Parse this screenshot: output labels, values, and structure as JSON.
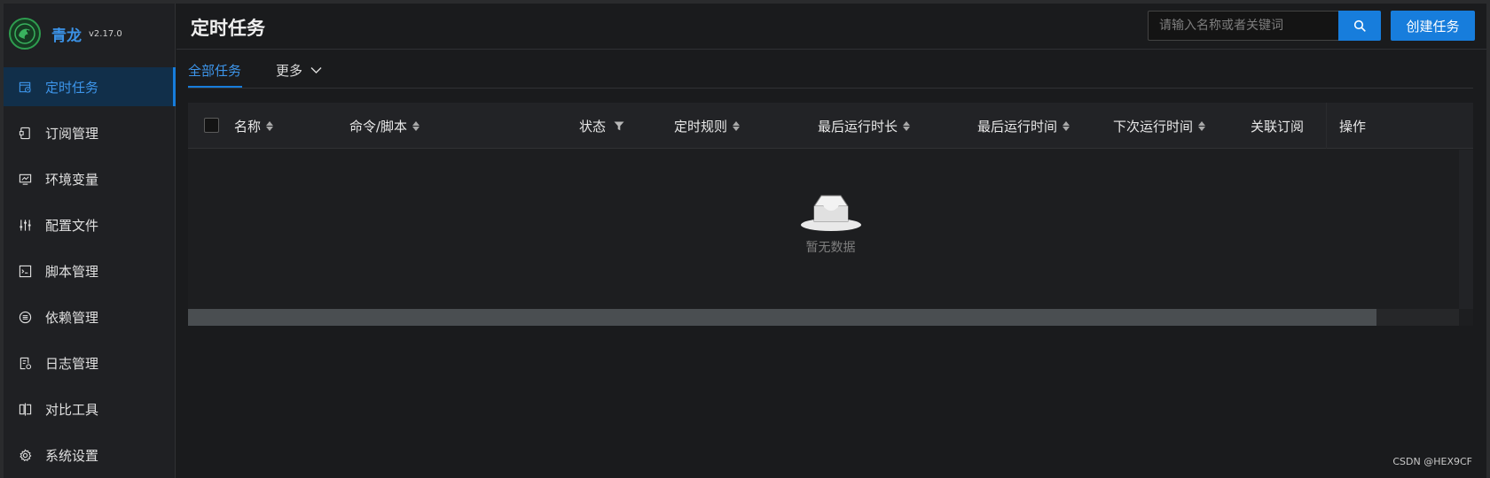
{
  "brand": {
    "name": "青龙",
    "version": "v2.17.0"
  },
  "sidebar": {
    "items": [
      {
        "label": "定时任务",
        "icon": "calendar-clock-icon",
        "active": true
      },
      {
        "label": "订阅管理",
        "icon": "subscription-icon",
        "active": false
      },
      {
        "label": "环境变量",
        "icon": "monitor-icon",
        "active": false
      },
      {
        "label": "配置文件",
        "icon": "sliders-icon",
        "active": false
      },
      {
        "label": "脚本管理",
        "icon": "code-file-icon",
        "active": false
      },
      {
        "label": "依赖管理",
        "icon": "list-circle-icon",
        "active": false
      },
      {
        "label": "日志管理",
        "icon": "log-file-icon",
        "active": false
      },
      {
        "label": "对比工具",
        "icon": "diff-icon",
        "active": false
      },
      {
        "label": "系统设置",
        "icon": "gear-icon",
        "active": false
      }
    ]
  },
  "header": {
    "title": "定时任务",
    "search_placeholder": "请输入名称或者关键词",
    "create_label": "创建任务"
  },
  "tabs": {
    "all_label": "全部任务",
    "more_label": "更多"
  },
  "table": {
    "columns": [
      {
        "label": "名称",
        "control": "sort"
      },
      {
        "label": "命令/脚本",
        "control": "sort"
      },
      {
        "label": "状态",
        "control": "filter"
      },
      {
        "label": "定时规则",
        "control": "sort"
      },
      {
        "label": "最后运行时长",
        "control": "sort"
      },
      {
        "label": "最后运行时间",
        "control": "sort"
      },
      {
        "label": "下次运行时间",
        "control": "sort"
      },
      {
        "label": "关联订阅",
        "control": "none"
      },
      {
        "label": "操作",
        "control": "none"
      }
    ],
    "empty_text": "暂无数据"
  },
  "watermark": "CSDN @HEX9CF",
  "colors": {
    "accent": "#177ddc",
    "background": "#1a1b1d",
    "sidebar_active_bg": "#112f4a",
    "brand_green": "#2e9d4f"
  }
}
